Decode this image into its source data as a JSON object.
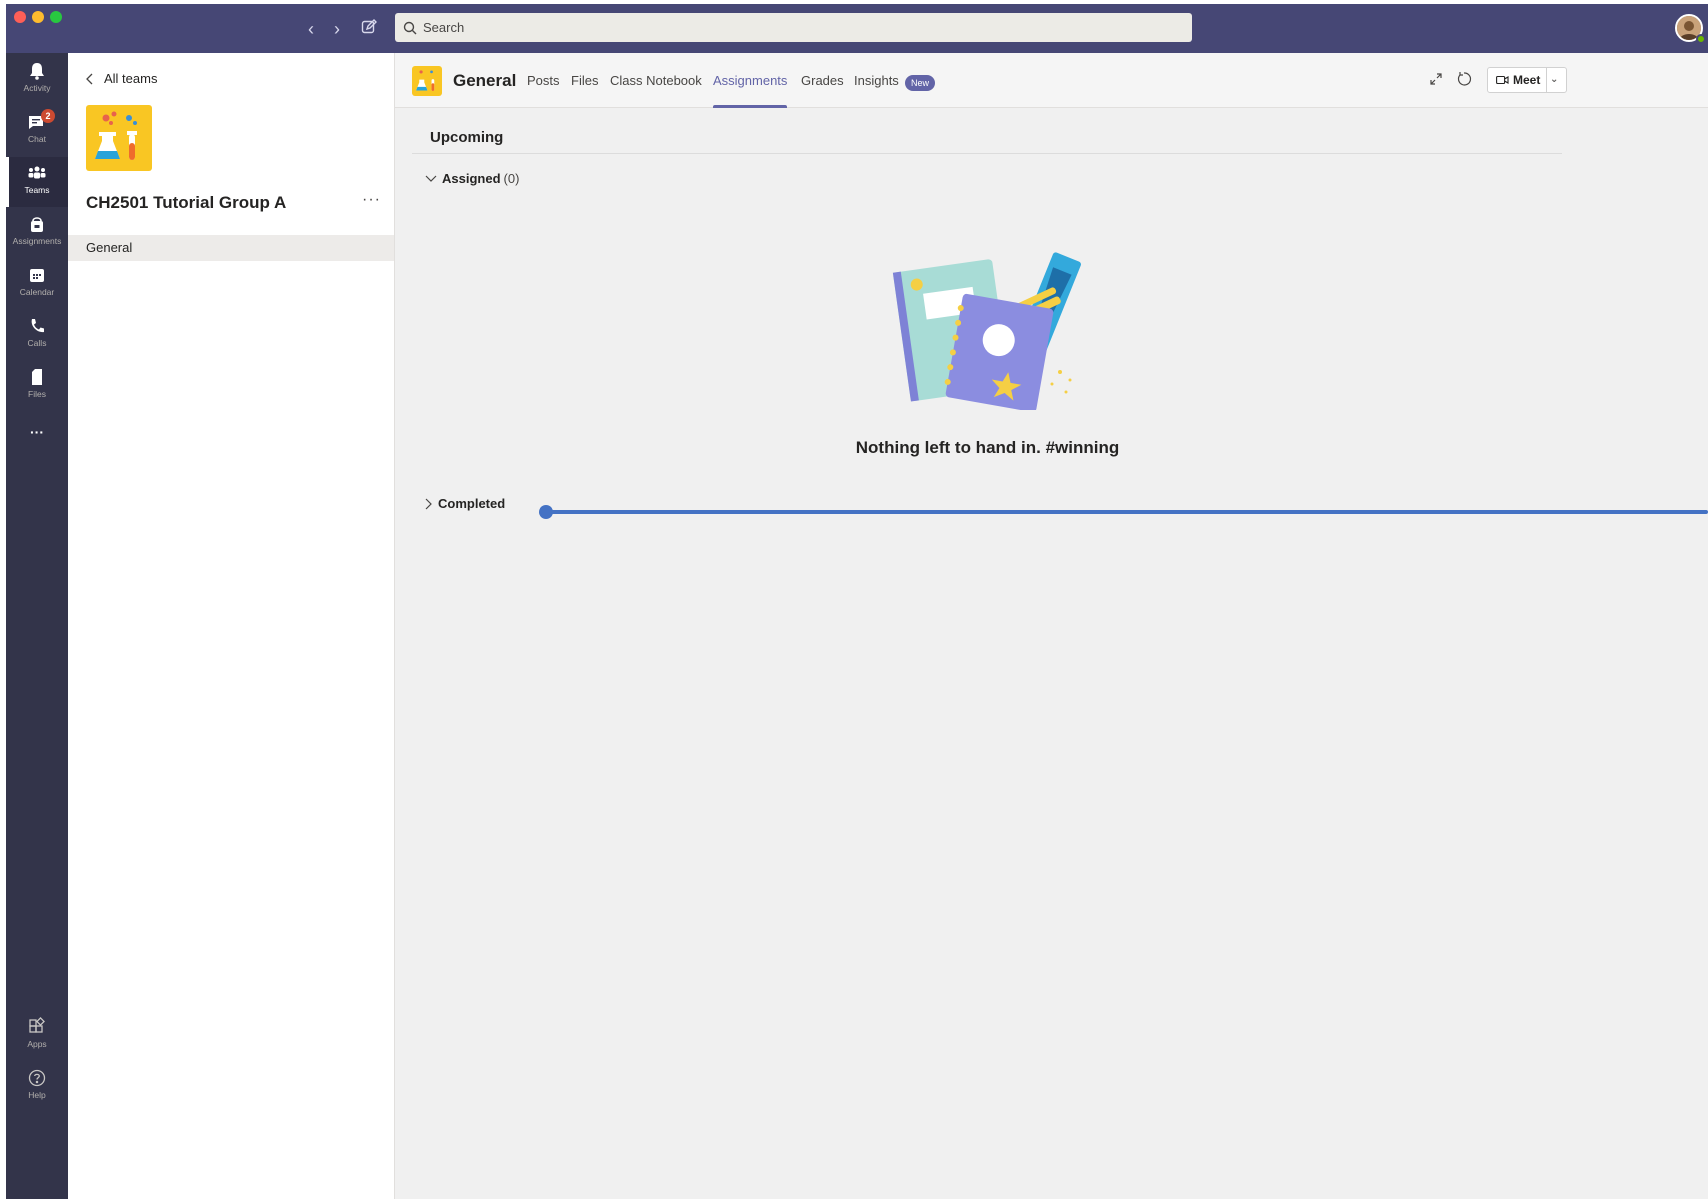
{
  "colors": {
    "titlebar": "#464775",
    "rail": "#33344a",
    "accent": "#6264a7",
    "badge": "#cc4a31",
    "slider": "#4472c4",
    "team_logo_bg": "#f9c623"
  },
  "titlebar": {
    "search_placeholder": "Search",
    "icons": [
      "back-icon",
      "forward-icon",
      "compose-icon",
      "search-icon",
      "avatar"
    ]
  },
  "rail": {
    "items": [
      {
        "label": "Activity",
        "icon": "bell-icon"
      },
      {
        "label": "Chat",
        "icon": "chat-icon",
        "badge": "2"
      },
      {
        "label": "Teams",
        "icon": "teams-icon",
        "active": true
      },
      {
        "label": "Assignments",
        "icon": "assignments-icon"
      },
      {
        "label": "Calendar",
        "icon": "calendar-icon"
      },
      {
        "label": "Calls",
        "icon": "phone-icon"
      },
      {
        "label": "Files",
        "icon": "file-icon"
      }
    ],
    "more": "···",
    "bottom": [
      {
        "label": "Apps",
        "icon": "apps-icon"
      },
      {
        "label": "Help",
        "icon": "help-icon"
      }
    ]
  },
  "team_panel": {
    "back_label": "All teams",
    "team_name": "CH2501 Tutorial Group A",
    "more": "···",
    "channels": [
      "General"
    ]
  },
  "header": {
    "channel_name": "General",
    "tabs": [
      "Posts",
      "Files",
      "Class Notebook",
      "Assignments",
      "Grades",
      "Insights"
    ],
    "active_tab": "Assignments",
    "new_badge": "New",
    "meet_label": "Meet"
  },
  "content": {
    "upcoming": "Upcoming",
    "assigned_label": "Assigned",
    "assigned_count": "(0)",
    "empty_message": "Nothing left to hand in. #winning",
    "completed_label": "Completed",
    "slider_value": 0
  }
}
